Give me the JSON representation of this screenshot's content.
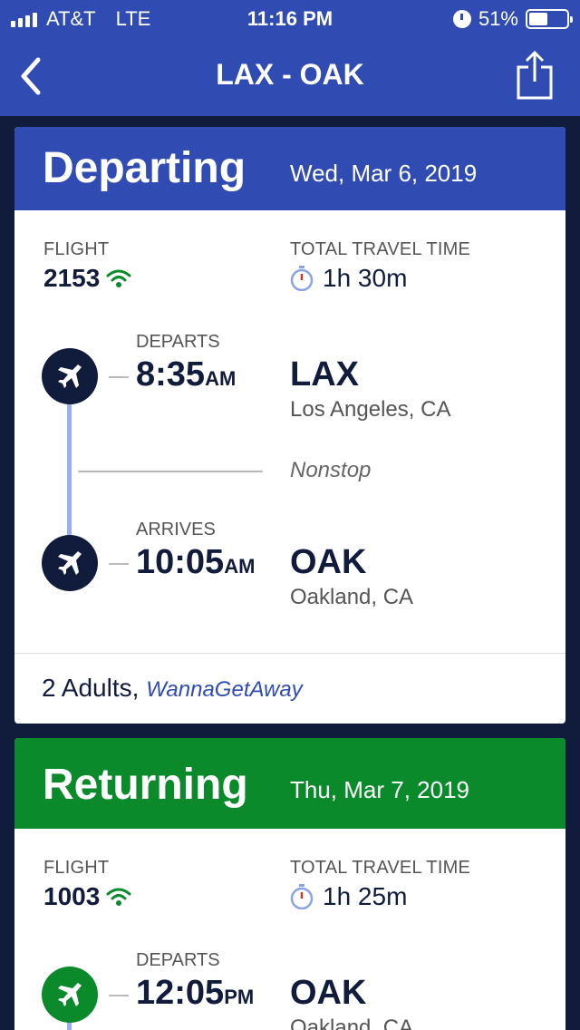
{
  "status_bar": {
    "carrier": "AT&T",
    "network": "LTE",
    "time": "11:16 PM",
    "battery_percent": "51%",
    "battery_level": 0.51
  },
  "nav": {
    "title": "LAX - OAK",
    "back_icon": "chevron-left-icon",
    "share_icon": "share-icon"
  },
  "colors": {
    "brand_blue": "#304cb2",
    "departing_header": "#304cb2",
    "returning_header": "#0a8a2a",
    "dark_navy": "#111c3d"
  },
  "departing": {
    "label": "Departing",
    "date": "Wed, Mar 6, 2019",
    "flight_label": "FLIGHT",
    "flight_number": "2153",
    "travel_label": "TOTAL TRAVEL TIME",
    "travel_time": "1h 30m",
    "departs_label": "DEPARTS",
    "departs_time": "8:35",
    "departs_ampm": "AM",
    "origin_code": "LAX",
    "origin_city": "Los Angeles, CA",
    "stops": "Nonstop",
    "arrives_label": "ARRIVES",
    "arrives_time": "10:05",
    "arrives_ampm": "AM",
    "dest_code": "OAK",
    "dest_city": "Oakland, CA",
    "passengers": "2 Adults,",
    "fare_type": "WannaGetAway"
  },
  "returning": {
    "label": "Returning",
    "date": "Thu, Mar 7, 2019",
    "flight_label": "FLIGHT",
    "flight_number": "1003",
    "travel_label": "TOTAL TRAVEL TIME",
    "travel_time": "1h 25m",
    "departs_label": "DEPARTS",
    "departs_time": "12:05",
    "departs_ampm": "PM",
    "origin_code": "OAK",
    "origin_city": "Oakland, CA"
  }
}
